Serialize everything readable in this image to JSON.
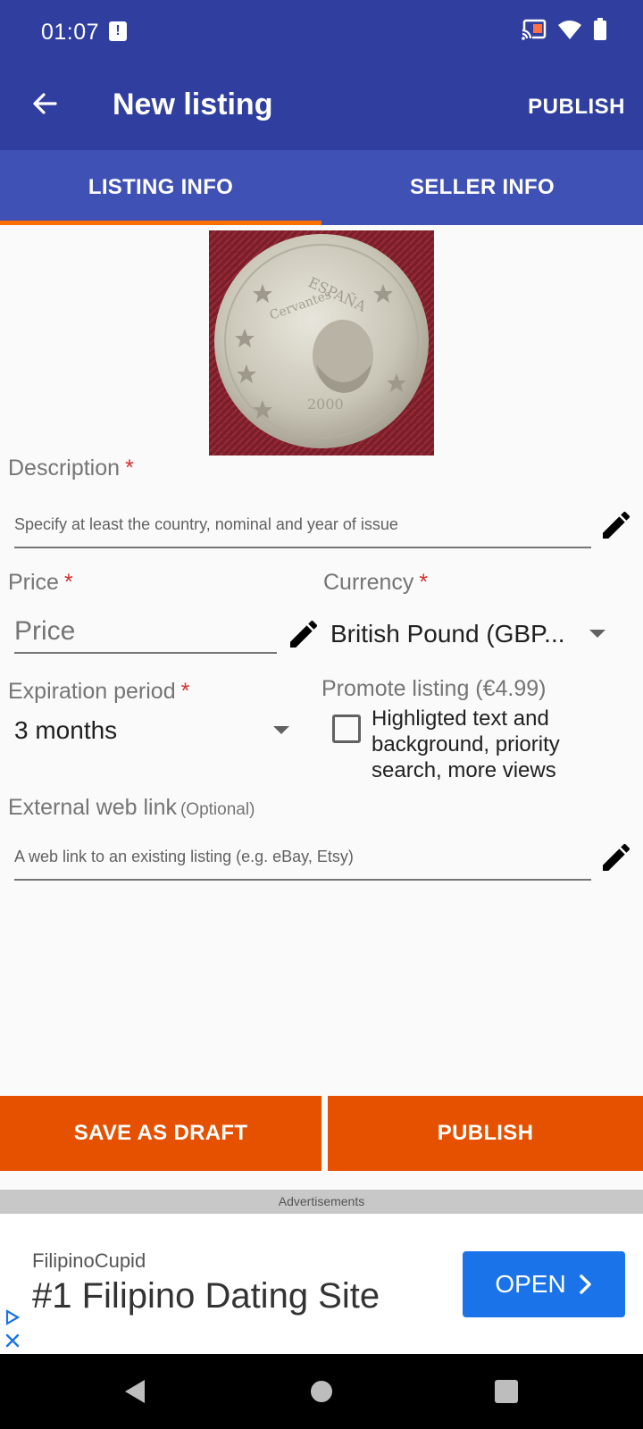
{
  "status_bar": {
    "time": "01:07",
    "icons": [
      "sd-card-alert-icon",
      "cast-icon",
      "wifi-icon",
      "battery-icon"
    ]
  },
  "app_bar": {
    "title": "New listing",
    "publish_label": "PUBLISH",
    "back_icon": "arrow-back-icon",
    "background_color": "#303f9f"
  },
  "tabs": [
    {
      "label": "LISTING INFO",
      "active": true
    },
    {
      "label": "SELLER INFO",
      "active": false
    }
  ],
  "form": {
    "description": {
      "label": "Description",
      "required_mark": "*",
      "placeholder": "Specify at least the country, nominal and year of issue"
    },
    "price": {
      "label": "Price",
      "required_mark": "*",
      "placeholder": "Price"
    },
    "currency": {
      "label": "Currency",
      "required_mark": "*",
      "value": "British Pound (GBP..."
    },
    "expiration": {
      "label": "Expiration period",
      "required_mark": "*",
      "value": "3 months"
    },
    "promote": {
      "label": "Promote listing (€4.99)",
      "checkbox_text": "Highligted text and background, priority search, more views",
      "checked": false
    },
    "external_link": {
      "label": "External web link",
      "optional_label": "(Optional)",
      "placeholder": "A web link to an existing listing (e.g. eBay, Etsy)"
    }
  },
  "actions": {
    "save_draft_label": "SAVE AS DRAFT",
    "publish_label": "PUBLISH",
    "button_color": "#e65100"
  },
  "ad": {
    "section_label": "Advertisements",
    "brand": "FilipinoCupid",
    "headline": "#1 Filipino Dating Site",
    "cta_label": "OPEN",
    "cta_color": "#1a73e8"
  },
  "nav_bar": {
    "icons": [
      "back-triangle-icon",
      "home-circle-icon",
      "recents-square-icon"
    ]
  },
  "colors": {
    "primary": "#303f9f",
    "tabs": "#3f51b5",
    "accent": "#ff6f00",
    "required": "#d32f2f"
  }
}
